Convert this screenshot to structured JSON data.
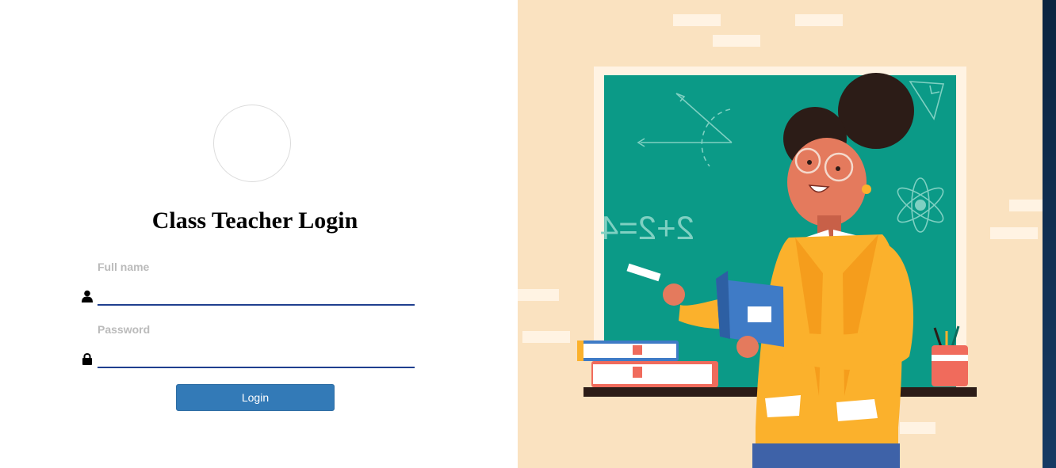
{
  "login": {
    "title": "Class Teacher Login",
    "fullname_label": "Full name",
    "fullname_value": "",
    "password_label": "Password",
    "password_value": "",
    "button_label": "Login"
  },
  "illustration": {
    "board_equation": "2+2=4",
    "colors": {
      "background": "#fae2c0",
      "chalkboard": "#0b9a87",
      "jacket": "#fbb12c",
      "button": "#337ab7",
      "input_underline": "#1f3f8f"
    }
  }
}
